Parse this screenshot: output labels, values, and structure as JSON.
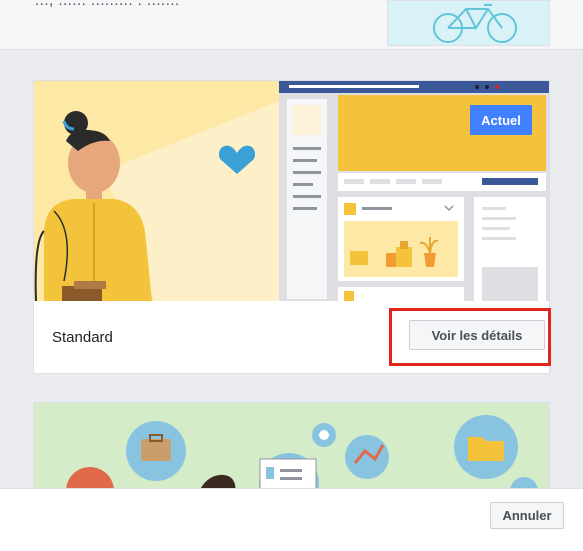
{
  "top_strip": {
    "partial_text": "..., ...... ......... . ......."
  },
  "layout_option": {
    "title": "Standard",
    "current_badge": "Actuel",
    "details_button": "Voir les détails"
  },
  "footer": {
    "cancel_button": "Annuler"
  },
  "colors": {
    "highlight": "#e3241b",
    "badge_blue": "#4080ff",
    "header_blue": "#3b5998",
    "heart": "#3ba0d6",
    "yellow": "#f5c33b",
    "green_banner": "#d4ecc8"
  }
}
